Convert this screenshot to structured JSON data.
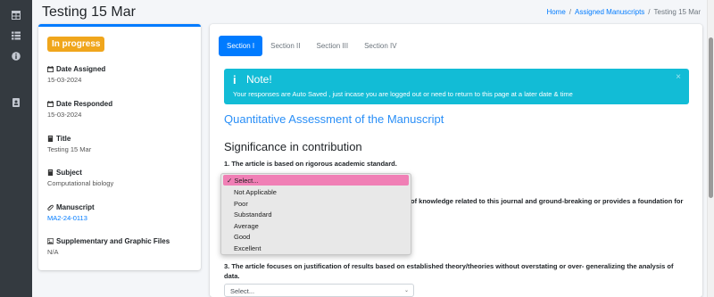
{
  "sidebar": {
    "icons": [
      "table-icon",
      "list-icon",
      "info-icon",
      "contact-card-icon"
    ]
  },
  "header": {
    "title": "Testing 15 Mar",
    "breadcrumb": {
      "home": "Home",
      "sep1": "/",
      "assigned": "Assigned Manuscripts",
      "sep2": "/",
      "current": "Testing 15 Mar"
    }
  },
  "info": {
    "status": "In progress",
    "status_color": "#f0a61c",
    "date_assigned_label": "Date Assigned",
    "date_assigned": "15-03-2024",
    "date_responded_label": "Date Responded",
    "date_responded": "15-03-2024",
    "title_label": "Title",
    "title": "Testing 15 Mar",
    "subject_label": "Subject",
    "subject": "Computational biology",
    "manuscript_label": "Manuscript",
    "manuscript": "MA2-24-0113",
    "files_label": "Supplementary and Graphic Files",
    "files": "N/A"
  },
  "tabs": [
    "Section I",
    "Section II",
    "Section III",
    "Section IV"
  ],
  "alert": {
    "icon": "i",
    "title": "Note!",
    "text": "Your responses are Auto Saved , just incase you are logged out or need to return to this page at a later date & time",
    "close": "×"
  },
  "section_title": "Quantitative Assessment of the Manuscript",
  "subsection_title": "Significance in contribution",
  "questions": {
    "q1": "1. The article is based on rigorous academic standard.",
    "q2_visible": "of knowledge related to this journal and ground-breaking or provides a foundation for",
    "q3": "3. The article focuses on justification of results based on established theory/theories without overstating or over- generalizing the analysis of data."
  },
  "select": {
    "placeholder": "Select...",
    "chevron": "⌄"
  },
  "dropdown": {
    "selected_mark": "✓",
    "options": [
      "Select...",
      "Not Applicable",
      "Poor",
      "Substandard",
      "Average",
      "Good",
      "Excellent"
    ]
  },
  "colors": {
    "primary": "#007bff",
    "alert_bg": "#12bcd6",
    "highlight": "#f07fb5",
    "sidebar": "#343a40"
  }
}
